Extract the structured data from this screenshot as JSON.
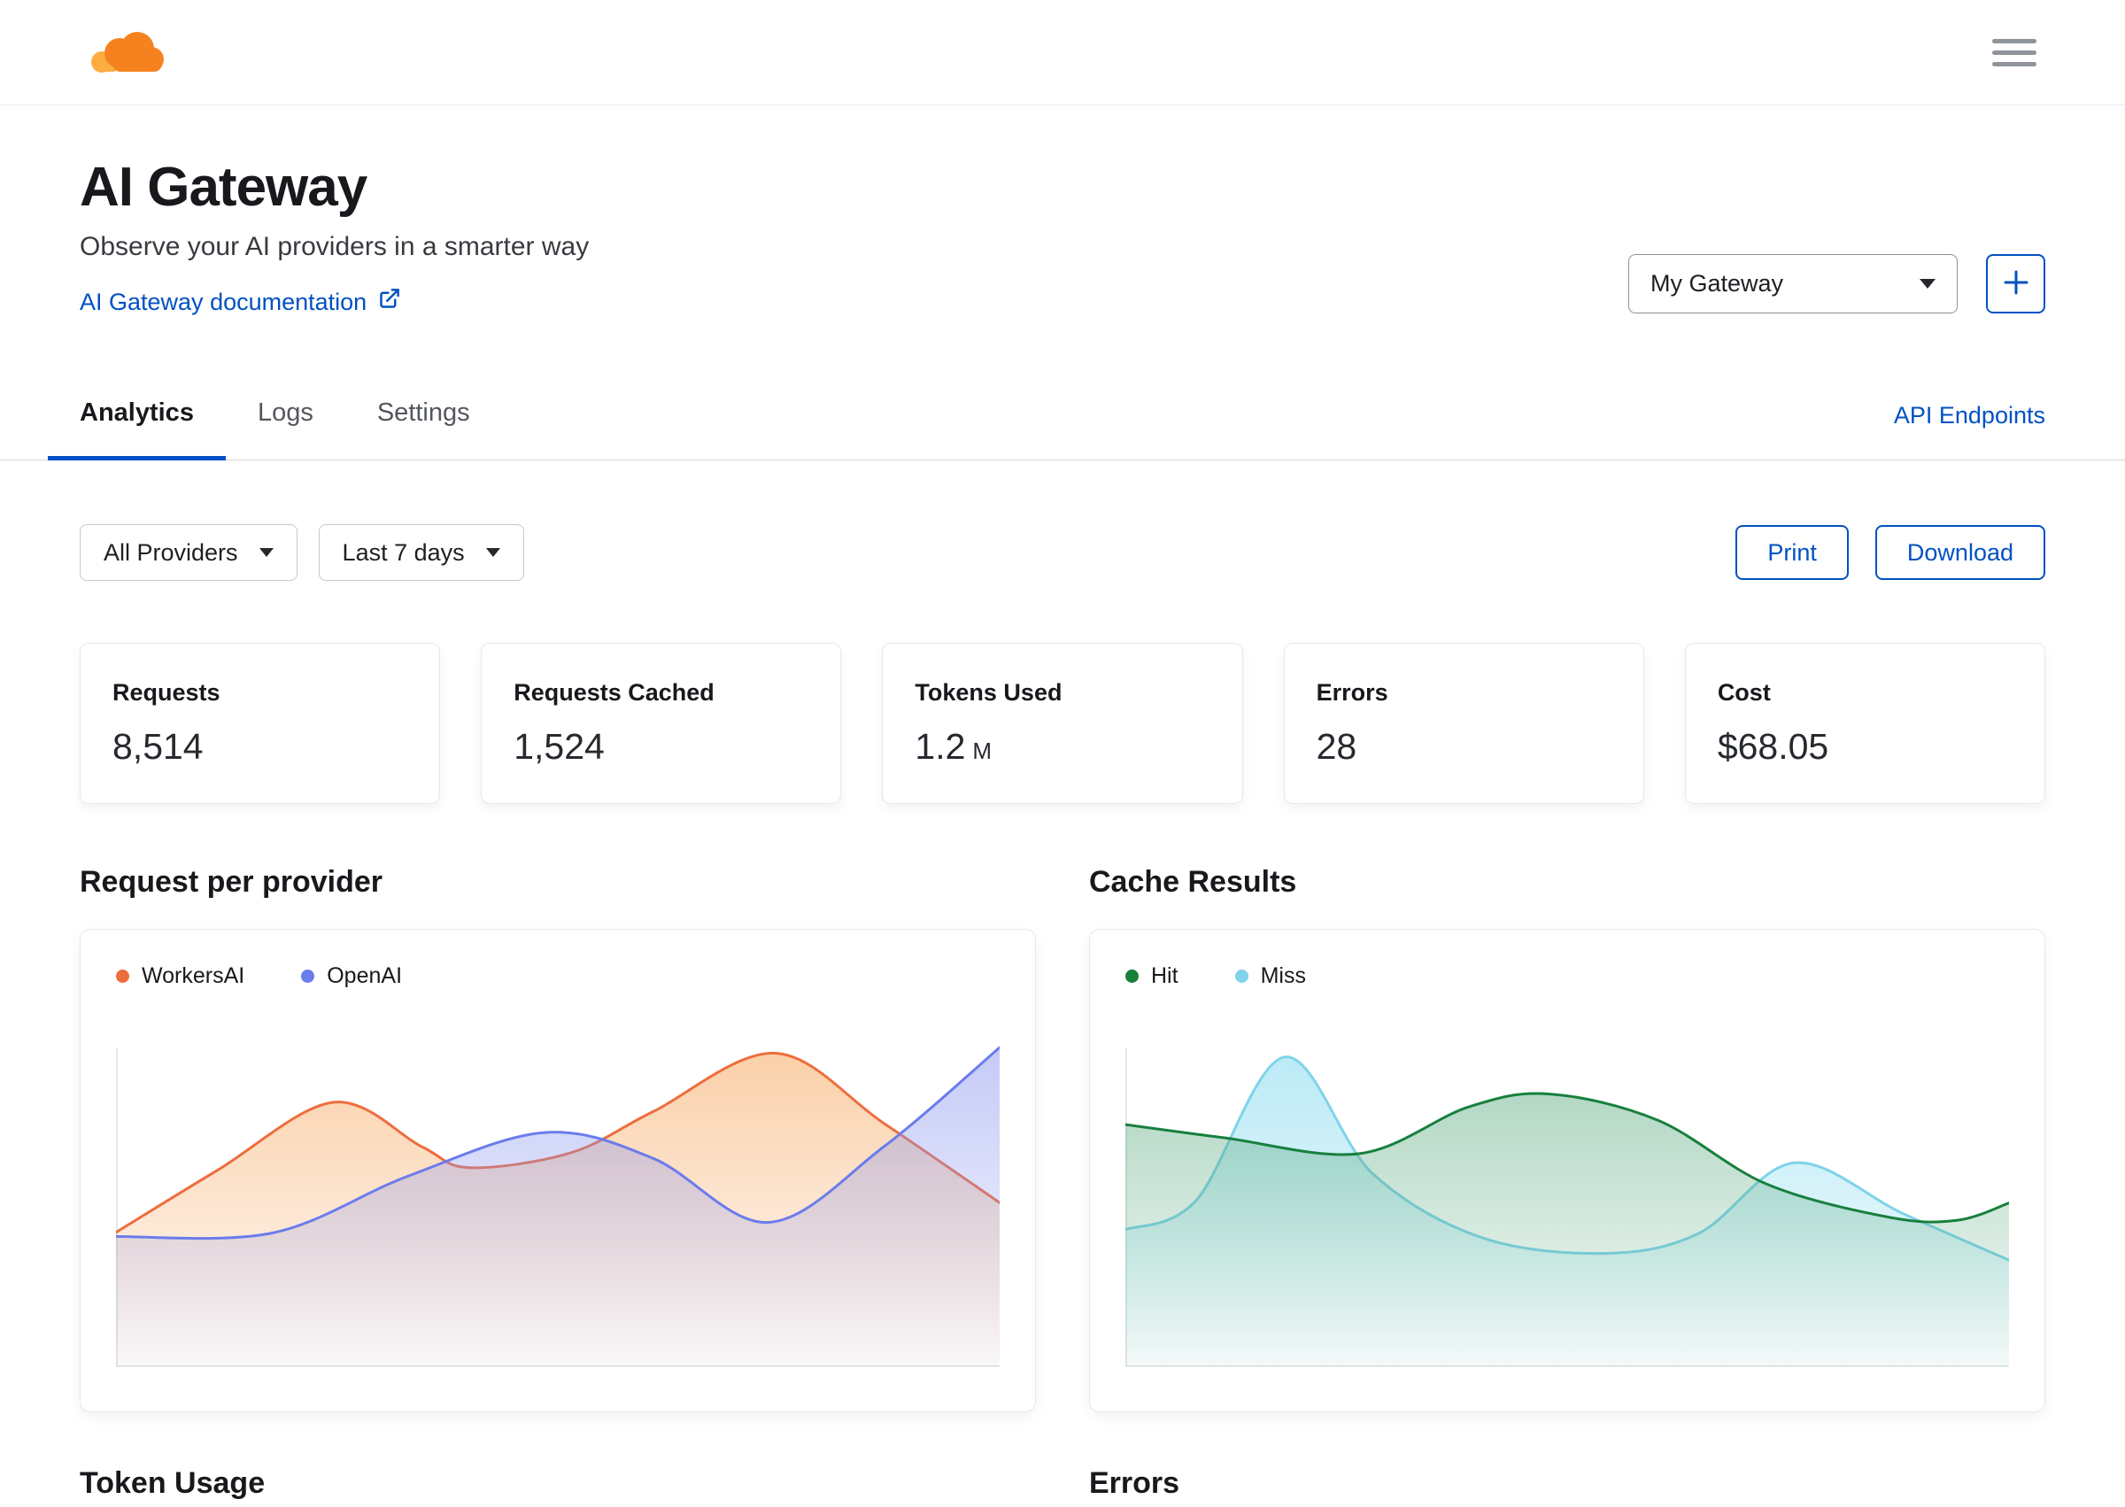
{
  "header": {
    "title": "AI Gateway",
    "subtitle": "Observe your AI providers in a smarter way",
    "doc_link": "AI Gateway documentation",
    "gateway_select": "My Gateway"
  },
  "tabs": {
    "items": [
      {
        "label": "Analytics",
        "active": true
      },
      {
        "label": "Logs",
        "active": false
      },
      {
        "label": "Settings",
        "active": false
      }
    ],
    "api_endpoints": "API Endpoints"
  },
  "filters": {
    "provider": "All Providers",
    "range": "Last 7 days",
    "print": "Print",
    "download": "Download"
  },
  "stats": [
    {
      "label": "Requests",
      "value": "8,514",
      "unit": ""
    },
    {
      "label": "Requests Cached",
      "value": "1,524",
      "unit": ""
    },
    {
      "label": "Tokens Used",
      "value": "1.2",
      "unit": "M"
    },
    {
      "label": "Errors",
      "value": "28",
      "unit": ""
    },
    {
      "label": "Cost",
      "value": "$68.05",
      "unit": ""
    }
  ],
  "sections": {
    "request_per_provider": "Request per provider",
    "cache_results": "Cache Results",
    "token_usage": "Token Usage",
    "errors": "Errors"
  },
  "colors": {
    "accent_blue": "#0051c3",
    "brand_orange": "#f6821f",
    "workers_ai": "#ee6d3d",
    "openai": "#6b7ceb",
    "hit_green": "#17803d",
    "miss_cyan": "#7fd3ea"
  },
  "chart_data": [
    {
      "type": "area",
      "title": "Request per provider",
      "legend_position": "top-left",
      "axes_visible": false,
      "x_range": [
        0,
        100
      ],
      "y_range": [
        0,
        100
      ],
      "series": [
        {
          "name": "WorkersAI",
          "color": "#ee6d3d",
          "fill": "#f7a963",
          "fo": 0.55,
          "z": 0,
          "x": [
            0,
            11.5,
            24.6,
            34.6,
            40,
            51.5,
            60.8,
            74.6,
            86.9,
            100
          ],
          "y": [
            42,
            61.5,
            82.8,
            68.9,
            62.3,
            67,
            79.9,
            98.2,
            76.2,
            51.3
          ]
        },
        {
          "name": "OpenAI",
          "color": "#6b7ceb",
          "fill": "#8a96ef",
          "fo": 0.5,
          "z": 1,
          "x": [
            0,
            17.7,
            33.1,
            48.5,
            60.8,
            73.8,
            86.9,
            100
          ],
          "y": [
            40.7,
            41.8,
            59.7,
            73.3,
            65.2,
            45.1,
            68.9,
            100
          ]
        }
      ]
    },
    {
      "type": "area",
      "title": "Cache Results",
      "legend_position": "top-left",
      "axes_visible": false,
      "x_range": [
        0,
        100
      ],
      "y_range": [
        0,
        100
      ],
      "series": [
        {
          "name": "Hit",
          "color": "#17803d",
          "fill": "#57a87d",
          "fo": 0.45,
          "z": 1,
          "x": [
            0,
            11.1,
            26.5,
            38.8,
            48,
            60.3,
            72.6,
            86.5,
            94.2,
            100
          ],
          "y": [
            75.8,
            71.7,
            66.7,
            81.3,
            85.4,
            77.1,
            57.1,
            46.7,
            45.8,
            51.2
          ]
        },
        {
          "name": "Miss",
          "color": "#7fd3ea",
          "fill": "#8edcef",
          "fo": 0.6,
          "z": 0,
          "x": [
            0,
            8,
            18,
            28,
            40.3,
            54.2,
            64.9,
            75.7,
            88,
            100
          ],
          "y": [
            42.9,
            52,
            97,
            60.4,
            40.4,
            35.4,
            41.7,
            63.8,
            47.9,
            33.3
          ]
        }
      ]
    }
  ]
}
